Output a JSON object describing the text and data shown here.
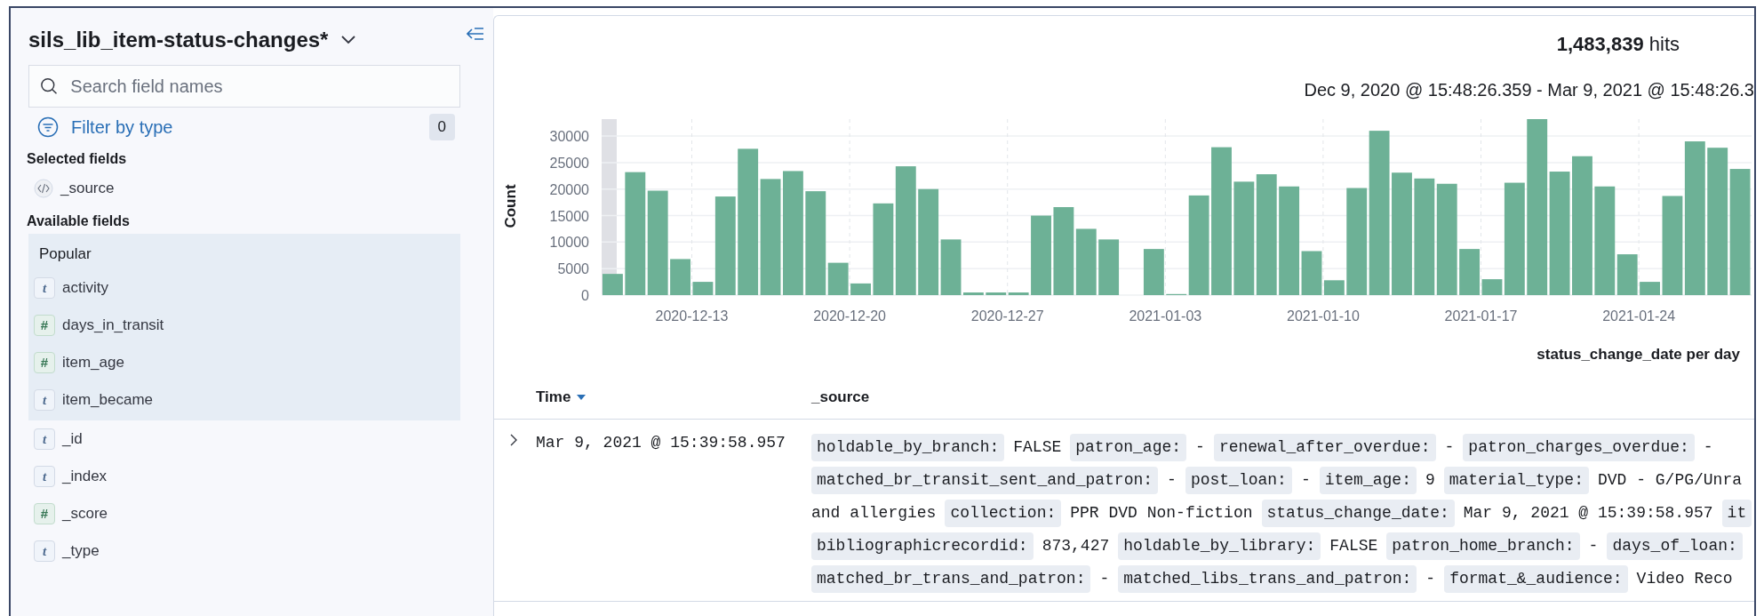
{
  "sidebar": {
    "index_pattern": "sils_lib_item-status-changes*",
    "search": {
      "placeholder": "Search field names"
    },
    "filter": {
      "label": "Filter by type",
      "count": "0"
    },
    "selected_fields": {
      "title": "Selected fields",
      "items": [
        {
          "name": "_source",
          "kind": "source"
        }
      ]
    },
    "available_fields": {
      "title": "Available fields",
      "popular": {
        "label": "Popular",
        "items": [
          {
            "name": "activity",
            "kind": "string",
            "glyph": "t"
          },
          {
            "name": "days_in_transit",
            "kind": "number",
            "glyph": "#"
          },
          {
            "name": "item_age",
            "kind": "number",
            "glyph": "#"
          },
          {
            "name": "item_became",
            "kind": "string",
            "glyph": "t"
          }
        ]
      },
      "items": [
        {
          "name": "_id",
          "kind": "string",
          "glyph": "t"
        },
        {
          "name": "_index",
          "kind": "string",
          "glyph": "t"
        },
        {
          "name": "_score",
          "kind": "number",
          "glyph": "#"
        },
        {
          "name": "_type",
          "kind": "string",
          "glyph": "t"
        }
      ]
    }
  },
  "main": {
    "hits": "**1,483,839** hits",
    "time_range": "Dec 9, 2020 @ 15:48:26.359 - Mar 9, 2021 @ 15:48:26.3",
    "chart_data": {
      "type": "bar",
      "ylabel": "Count",
      "xlabel": "status_change_date per day",
      "categories": [
        null,
        null,
        null,
        null,
        "2020-12-13",
        null,
        null,
        null,
        null,
        null,
        null,
        "2020-12-20",
        null,
        null,
        null,
        null,
        null,
        null,
        "2020-12-27",
        null,
        null,
        null,
        null,
        null,
        null,
        "2021-01-03",
        null,
        null,
        null,
        null,
        null,
        null,
        "2021-01-10",
        null,
        null,
        null,
        null,
        null,
        null,
        "2021-01-17",
        null,
        null,
        null,
        null,
        null,
        null,
        "2021-01-24",
        null,
        null,
        null,
        null
      ],
      "ylim": [
        0,
        33200
      ],
      "grid": true,
      "series": [
        {
          "color": "#6db196",
          "values": [
            4000,
            23200,
            19700,
            6800,
            2500,
            18600,
            27600,
            21900,
            23400,
            19600,
            6100,
            2200,
            17300,
            24300,
            20000,
            10500,
            500,
            500,
            500,
            15000,
            16600,
            12500,
            10500,
            0,
            8700,
            200,
            18800,
            27900,
            21400,
            22800,
            20500,
            8300,
            2800,
            20200,
            31000,
            23100,
            22000,
            21000,
            8700,
            3000,
            21200,
            33200,
            23300,
            26200,
            20500,
            7700,
            2500,
            18700,
            29000,
            27800,
            23800
          ]
        }
      ],
      "yticks": [
        0,
        5000,
        10000,
        15000,
        20000,
        25000,
        30000
      ]
    },
    "table": {
      "columns": [
        {
          "label": "Time",
          "sorted": true
        },
        {
          "label": "_source",
          "sorted": false
        }
      ],
      "rows": [
        {
          "expanded": false,
          "time": "Mar 9, 2021 @ 15:39:58.957",
          "source_lines": [
            [
              {
                "key": "holdable_by_branch:",
                "value": "FALSE"
              },
              {
                "key": "patron_age:",
                "value": "-"
              },
              {
                "key": "renewal_after_overdue:",
                "value": "-"
              },
              {
                "key": "patron_charges_overdue:",
                "value": "-"
              }
            ],
            [
              {
                "key": "matched_br_transit_sent_and_patron:",
                "value": "-"
              },
              {
                "key": "post_loan:",
                "value": "-"
              },
              {
                "key": "item_age:",
                "value": "9"
              },
              {
                "key": "material_type:",
                "value": "DVD - G/PG/Unra"
              }
            ],
            [
              {
                "value": "and allergies"
              },
              {
                "key": "collection:",
                "value": "PPR DVD Non-fiction"
              },
              {
                "key": "status_change_date:",
                "value": "Mar 9, 2021 @ 15:39:58.957"
              },
              {
                "key": "it"
              }
            ],
            [
              {
                "key": "bibliographicrecordid:",
                "value": "873,427"
              },
              {
                "key": "holdable_by_library:",
                "value": "FALSE"
              },
              {
                "key": "patron_home_branch:",
                "value": "-"
              },
              {
                "key": "days_of_loan:"
              }
            ],
            [
              {
                "key": "matched_br_trans_and_patron:",
                "value": "-"
              },
              {
                "key": "matched_libs_trans_and_patron:",
                "value": "-"
              },
              {
                "key": "format_&_audience:",
                "value": "Video Reco"
              }
            ]
          ]
        }
      ]
    }
  }
}
